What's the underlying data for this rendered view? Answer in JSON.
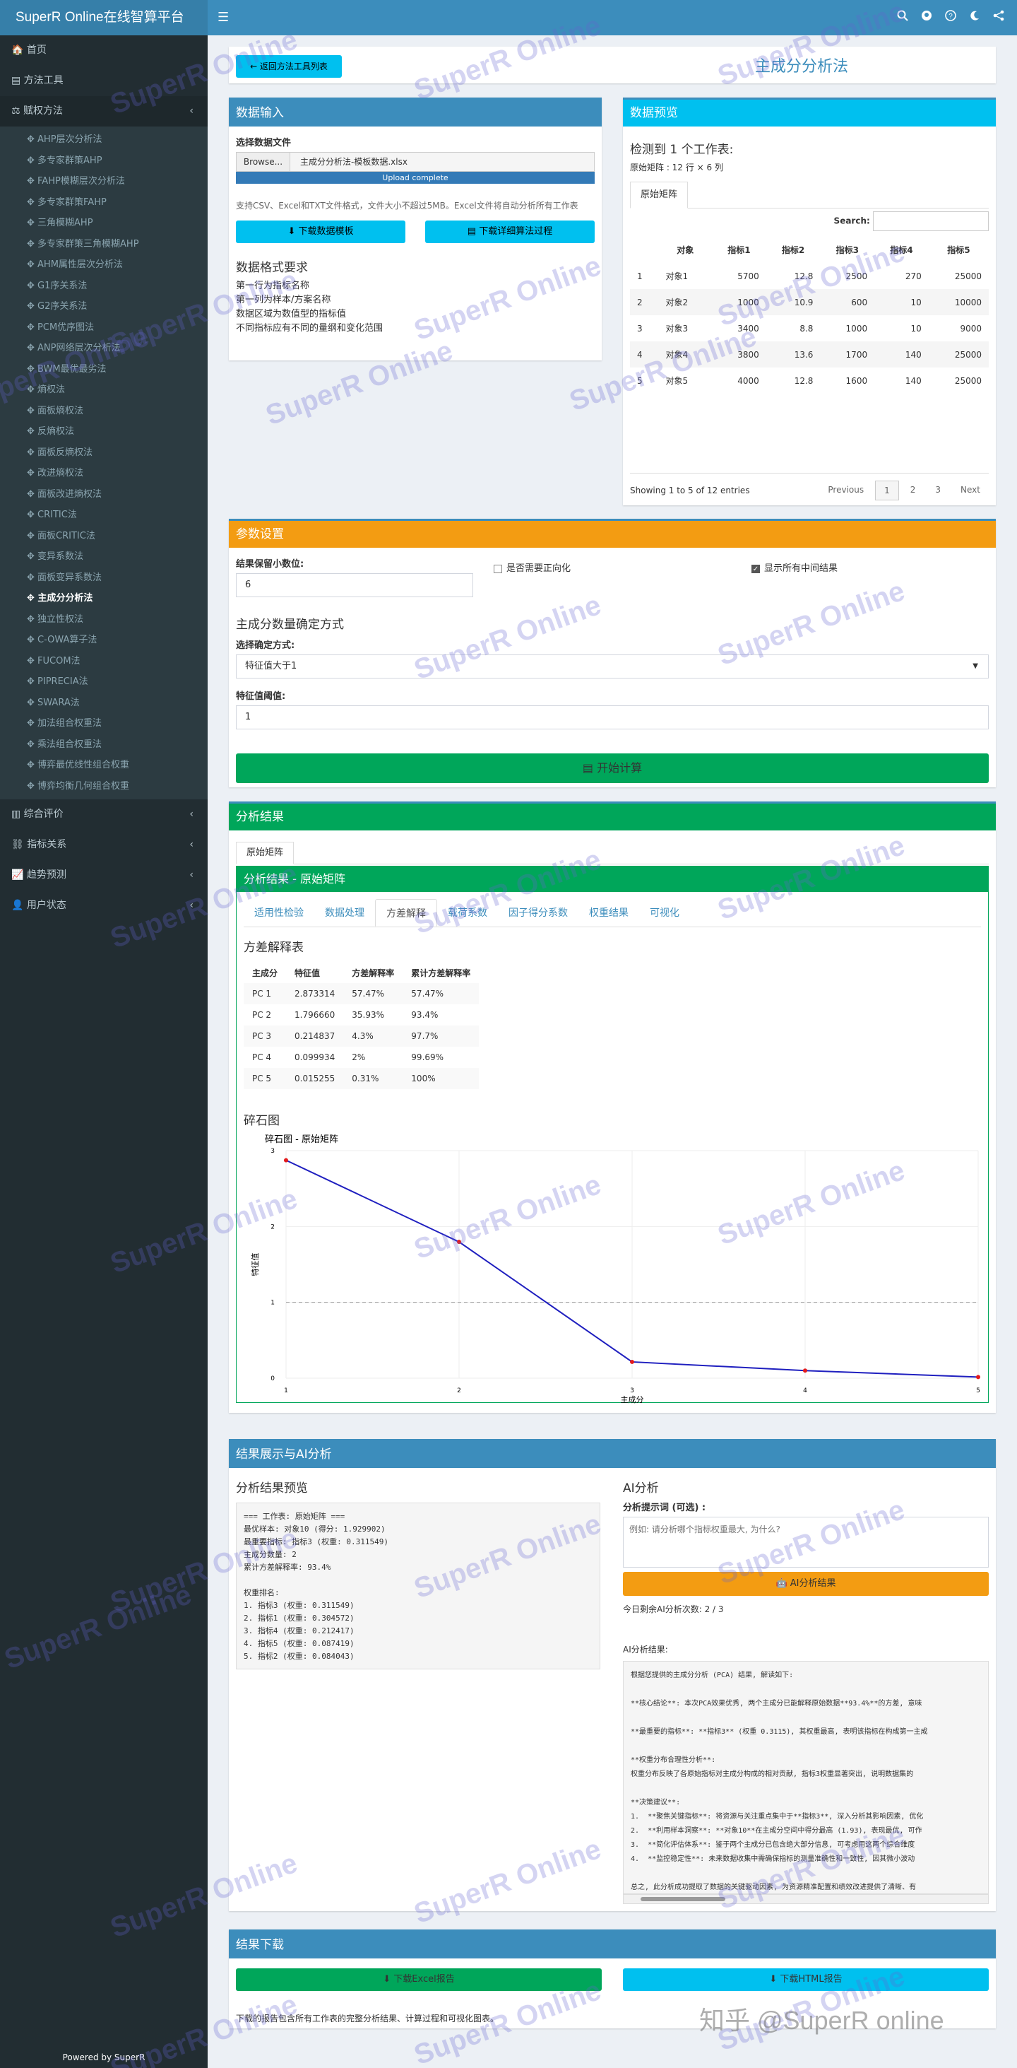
{
  "app": {
    "title": "SuperR Online在线智算平台",
    "menu_icon": "☰",
    "header_icons": [
      "search-icon",
      "github-icon",
      "help-icon",
      "moon-icon",
      "share-icon"
    ]
  },
  "sidebar": {
    "top": [
      {
        "icon": "🏠",
        "label": "首页"
      },
      {
        "icon": "▤",
        "label": "方法工具"
      }
    ],
    "group": {
      "icon": "⚖",
      "label": "赋权方法",
      "arrow": "‹"
    },
    "sub": [
      "AHP层次分析法",
      "多专家群策AHP",
      "FAHP模糊层次分析法",
      "多专家群策FAHP",
      "三角模糊AHP",
      "多专家群策三角模糊AHP",
      "AHM属性层次分析法",
      "G1序关系法",
      "G2序关系法",
      "PCM优序图法",
      "ANP网络层次分析法",
      "BWM最优最劣法",
      "熵权法",
      "面板熵权法",
      "反熵权法",
      "面板反熵权法",
      "改进熵权法",
      "面板改进熵权法",
      "CRITIC法",
      "面板CRITIC法",
      "变异系数法",
      "面板变异系数法",
      "主成分分析法",
      "独立性权法",
      "C-OWA算子法",
      "FUCOM法",
      "PIPRECIA法",
      "SWARA法",
      "加法组合权重法",
      "乘法组合权重法",
      "博弈最优线性组合权重",
      "博弈均衡几何组合权重"
    ],
    "active": 22,
    "bottom": [
      {
        "icon": "▥",
        "label": "综合评价"
      },
      {
        "icon": "⛓",
        "label": "指标关系"
      },
      {
        "icon": "📈",
        "label": "趋势预测"
      },
      {
        "icon": "👤",
        "label": "用户状态"
      }
    ],
    "arrow": "‹",
    "powered": "Powered by SuperR"
  },
  "top": {
    "back": "← 返回方法工具列表",
    "title": "主成分分析法"
  },
  "input": {
    "title": "数据输入",
    "file_label": "选择数据文件",
    "browse": "Browse...",
    "file": "主成分分析法-模板数据.xlsx",
    "upload": "Upload complete",
    "note": "支持CSV、Excel和TXT文件格式，文件大小不超过5MB。Excel文件将自动分析所有工作表",
    "btn1": "⬇ 下载数据模板",
    "btn2": "▤ 下载详细算法过程",
    "fmt_title": "数据格式要求",
    "fmt": [
      "第一行为指标名称",
      "第一列为样本/方案名称",
      "数据区域为数值型的指标值",
      "不同指标应有不同的量纲和变化范围"
    ]
  },
  "preview": {
    "title": "数据预览",
    "detect": "检测到 1 个工作表:",
    "dim": "原始矩阵 : 12 行 × 6 列",
    "tab": "原始矩阵",
    "search": "Search:",
    "headers": [
      "",
      "对象",
      "指标1",
      "指标2",
      "指标3",
      "指标4",
      "指标5"
    ],
    "rows": [
      [
        "1",
        "对象1",
        "5700",
        "12.8",
        "2500",
        "270",
        "25000"
      ],
      [
        "2",
        "对象2",
        "1000",
        "10.9",
        "600",
        "10",
        "10000"
      ],
      [
        "3",
        "对象3",
        "3400",
        "8.8",
        "1000",
        "10",
        "9000"
      ],
      [
        "4",
        "对象4",
        "3800",
        "13.6",
        "1700",
        "140",
        "25000"
      ],
      [
        "5",
        "对象5",
        "4000",
        "12.8",
        "1600",
        "140",
        "25000"
      ]
    ],
    "info": "Showing 1 to 5 of 12 entries",
    "pages": [
      "Previous",
      "1",
      "2",
      "3",
      "Next"
    ]
  },
  "params": {
    "title": "参数设置",
    "dec_label": "结果保留小数位:",
    "dec": "6",
    "cb1": "是否需要正向化",
    "cb2": "显示所有中间结果",
    "sub": "主成分数量确定方式",
    "method_label": "选择确定方式:",
    "method": "特征值大于1",
    "eig_label": "特征值阈值:",
    "eig": "1",
    "run": "▤ 开始计算"
  },
  "results": {
    "title": "分析结果",
    "tab": "原始矩阵",
    "inner": "分析结果 - 原始矩阵",
    "tabs": [
      "适用性检验",
      "数据处理",
      "方差解释",
      "载荷系数",
      "因子得分系数",
      "权重结果",
      "可视化"
    ],
    "active_tab": 2,
    "var_title": "方差解释表",
    "var_headers": [
      "主成分",
      "特征值",
      "方差解释率",
      "累计方差解释率"
    ],
    "var_rows": [
      [
        "PC 1",
        "2.873314",
        "57.47%",
        "57.47%"
      ],
      [
        "PC 2",
        "1.796660",
        "35.93%",
        "93.4%"
      ],
      [
        "PC 3",
        "0.214837",
        "4.3%",
        "97.7%"
      ],
      [
        "PC 4",
        "0.099934",
        "2%",
        "99.69%"
      ],
      [
        "PC 5",
        "0.015255",
        "0.31%",
        "100%"
      ]
    ],
    "scree_title": "碎石图",
    "chart_title": "碎石图 - 原始矩阵"
  },
  "chart_data": {
    "type": "line",
    "title": "碎石图 - 原始矩阵",
    "xlabel": "主成分",
    "ylabel": "特征值",
    "x": [
      1,
      2,
      3,
      4,
      5
    ],
    "series": [
      {
        "values": [
          2.873314,
          1.79666,
          0.214837,
          0.099934,
          0.015255
        ]
      }
    ],
    "xlim": [
      1,
      5
    ],
    "ylim": [
      0,
      3
    ],
    "yticks": [
      0,
      1,
      2,
      3
    ],
    "reference_line": 1,
    "colors": {
      "line": "#1f1fbf",
      "point": "#e31a1c",
      "ref": "#999999"
    },
    "grid": true
  },
  "ai": {
    "title": "结果展示与AI分析",
    "preview_title": "分析结果预览",
    "preview_lines": [
      "=== 工作表: 原始矩阵 ===",
      "最优样本: 对象10 (得分: 1.929902)",
      "最重要指标: 指标3 (权重: 0.311549)",
      "主成分数量: 2",
      "累计方差解释率: 93.4%",
      "",
      "权重排名:",
      "1. 指标3 (权重: 0.311549)",
      "2. 指标1 (权重: 0.304572)",
      "3. 指标4 (权重: 0.212417)",
      "4. 指标5 (权重: 0.087419)",
      "5. 指标2 (权重: 0.084043)"
    ],
    "ai_title": "AI分析",
    "prompt_label": "分析提示词 (可选) :",
    "prompt_ph": "例如: 请分析哪个指标权重最大, 为什么?",
    "btn": "🤖 AI分析结果",
    "remain": "今日剩余AI分析次数: 2 / 3",
    "result_label": "AI分析结果:",
    "result_lines": [
      "根据您提供的主成分分析 (PCA) 结果, 解读如下:",
      "",
      "**核心结论**: 本次PCA效果优秀, 两个主成分已能解释原始数据**93.4%**的方差, 意味",
      "",
      "**最重要的指标**: **指标3** (权重 0.3115), 其权重最高, 表明该指标在构成第一主成",
      "",
      "**权重分布合理性分析**:",
      "权重分布反映了各原始指标对主成分构成的相对贡献, 指标3权重显著突出, 说明数据集的",
      "",
      "**决策建议**:",
      "1.  **聚焦关键指标**: 将资源与关注重点集中于**指标3**, 深入分析其影响因素, 优化",
      "2.  **利用样本洞察**: **对象10**在主成分空间中得分最高 (1.93), 表现最优, 可作",
      "3.  **简化评估体系**: 鉴于两个主成分已包含绝大部分信息, 可考虑用这两个综合维度",
      "4.  **监控稳定性**: 未来数据收集中需确保指标的测量准确性和一致性, 因其微小波动",
      "",
      "总之, 此分析成功提取了数据的关键驱动因素, 为资源精准配置和绩效改进提供了清晰、有"
    ]
  },
  "download": {
    "title": "结果下载",
    "excel": "⬇ 下载Excel报告",
    "html": "⬇ 下载HTML报告",
    "note": "下载的报告包含所有工作表的完整分析结果、计算过程和可视化图表。"
  },
  "watermark": {
    "text": "SuperR Online",
    "zhihu": "知乎 @SuperR online"
  }
}
